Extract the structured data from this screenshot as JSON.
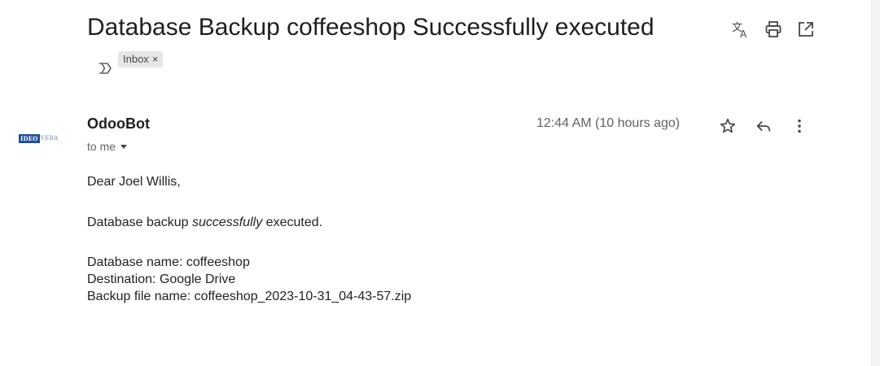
{
  "email": {
    "subject": "Database Backup coffeeshop Successfully executed",
    "label": "Inbox",
    "label_close": "×",
    "sender": "OdooBot",
    "recipient": "to me",
    "timestamp": "12:44 AM (10 hours ago)",
    "avatar": {
      "logo_box": "IDEO",
      "logo_text": "VERA"
    },
    "body": {
      "greeting": "Dear Joel Willis,",
      "line1_prefix": "Database backup ",
      "line1_emphasis": "successfully",
      "line1_suffix": " executed.",
      "database_name": "Database name: coffeeshop",
      "destination": "Destination: Google Drive",
      "backup_file": "Backup file name: coffeeshop_2023-10-31_04-43-57.zip"
    }
  },
  "icons": {
    "top_actions": [
      "translate-icon",
      "print-icon",
      "open-in-new-window-icon"
    ],
    "message_actions": [
      "star-icon",
      "reply-icon",
      "more-vert-icon"
    ],
    "label_marker": "label-importance-icon"
  },
  "colors": {
    "chip_bg": "#e6e6e6",
    "logo_blue": "#1e4f99",
    "muted_text": "#5f6368"
  }
}
